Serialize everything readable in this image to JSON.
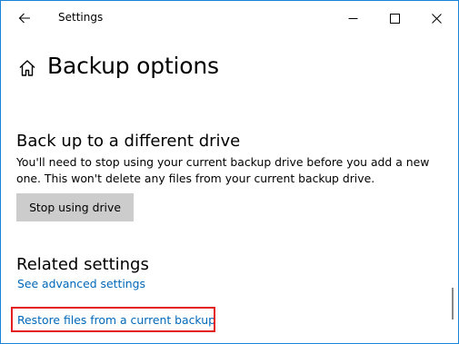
{
  "window": {
    "title": "Settings",
    "border_color": "#1883d7"
  },
  "icons": {
    "back": "back-arrow-icon",
    "minimize": "minimize-icon",
    "maximize": "maximize-icon",
    "close": "close-icon",
    "home": "home-icon"
  },
  "page": {
    "title": "Backup options"
  },
  "backup_section": {
    "heading": "Back up to a different drive",
    "description": "You'll need to stop using your current backup drive before you add a new one. This won't delete any files from your current backup drive.",
    "button_label": "Stop using drive"
  },
  "related_section": {
    "heading": "Related settings",
    "links": [
      "See advanced settings",
      "Restore files from a current backup"
    ],
    "link_color": "#0067b8",
    "highlight_color": "#e31f1f"
  }
}
